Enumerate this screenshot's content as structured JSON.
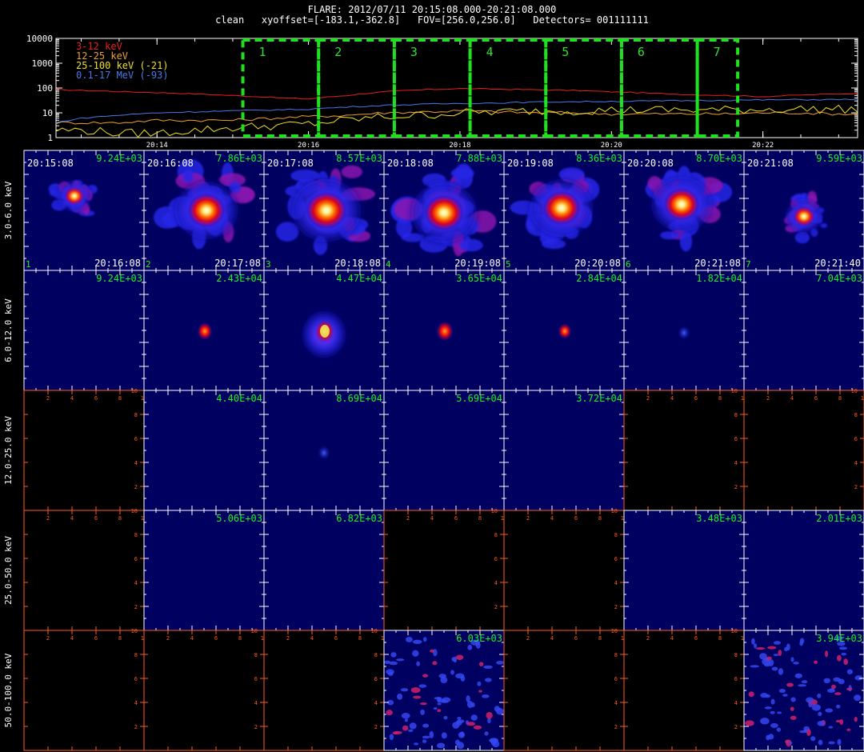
{
  "header": {
    "line1": "FLARE: 2012/07/11 20:15:08.000-20:21:08.000",
    "line2": "clean   xyoffset=[-183.1,-362.8]   FOV=[256.0,256.0]   Detectors= 001111111"
  },
  "chart_data": [
    {
      "type": "line",
      "description": "lightcurve",
      "yscale": "log",
      "ylim": [
        1,
        10000
      ],
      "y_tick_labels": [
        "1",
        "10",
        "100",
        "1000",
        "10000"
      ],
      "x_range": [
        "20:12:40",
        "20:23:15"
      ],
      "x_tick_labels": [
        "20:14",
        "20:16",
        "20:18",
        "20:20",
        "20:22"
      ],
      "grid": false,
      "legend_position": "top-left",
      "intervals": [
        {
          "label": "1",
          "start": "20:15:08",
          "end": "20:16:08"
        },
        {
          "label": "2",
          "start": "20:16:08",
          "end": "20:17:08"
        },
        {
          "label": "3",
          "start": "20:17:08",
          "end": "20:18:08"
        },
        {
          "label": "4",
          "start": "20:18:08",
          "end": "20:19:08"
        },
        {
          "label": "5",
          "start": "20:19:08",
          "end": "20:20:08"
        },
        {
          "label": "6",
          "start": "20:20:08",
          "end": "20:21:08"
        },
        {
          "label": "7",
          "start": "20:21:08",
          "end": "20:21:40"
        }
      ],
      "x": [
        "20:12:40",
        "20:13:00",
        "20:13:30",
        "20:14:00",
        "20:14:30",
        "20:15:00",
        "20:15:30",
        "20:16:00",
        "20:16:30",
        "20:17:00",
        "20:17:30",
        "20:18:00",
        "20:18:30",
        "20:19:00",
        "20:19:30",
        "20:20:00",
        "20:20:30",
        "20:21:00",
        "20:21:30",
        "20:22:00",
        "20:22:30",
        "20:23:00",
        "20:23:15"
      ],
      "series": [
        {
          "name": "3-12 keV",
          "color": "#e8201c",
          "values": [
            85,
            80,
            72,
            65,
            58,
            50,
            42,
            36,
            50,
            70,
            85,
            95,
            90,
            85,
            80,
            70,
            62,
            55,
            50,
            45,
            52,
            58,
            60
          ]
        },
        {
          "name": "12-25 keV",
          "color": "#f0a030",
          "values": [
            4,
            4,
            4,
            5,
            5,
            5,
            6,
            7,
            8,
            10,
            11,
            12,
            11,
            10,
            10,
            9,
            9,
            9,
            9,
            10,
            10,
            9,
            9
          ]
        },
        {
          "name": "25-100 keV (-21)",
          "color": "#f0e020",
          "values": [
            2,
            2,
            1.5,
            1.5,
            2,
            2.5,
            3,
            3.5,
            5,
            7,
            8,
            10,
            11,
            12,
            12,
            13,
            13,
            13,
            13,
            14,
            14,
            14,
            14
          ]
        },
        {
          "name": "0.1-17 MeV (-93)",
          "color": "#4a78e8",
          "values": [
            4,
            6,
            8,
            10,
            11,
            12,
            13,
            14,
            17,
            20,
            22,
            24,
            25,
            27,
            28,
            29,
            30,
            31,
            32,
            33,
            34,
            34,
            35
          ]
        }
      ]
    },
    {
      "type": "heatmap",
      "description": "image-grid",
      "colormap": "black-blue-red-orange-yellow-white",
      "row_labels": [
        "3.0-6.0 keV",
        "6.0-12.0 keV",
        "12.0-25.0 keV",
        "25.0-50.0 keV",
        "50.0-100.0 keV"
      ],
      "columns": [
        {
          "index": "1",
          "start": "20:15:08",
          "end": "20:16:08"
        },
        {
          "index": "2",
          "start": "20:16:08",
          "end": "20:17:08"
        },
        {
          "index": "3",
          "start": "20:17:08",
          "end": "20:18:08"
        },
        {
          "index": "4",
          "start": "20:18:08",
          "end": "20:19:08"
        },
        {
          "index": "5",
          "start": "20:19:08",
          "end": "20:20:08"
        },
        {
          "index": "6",
          "start": "20:20:08",
          "end": "20:21:08"
        },
        {
          "index": "7",
          "start": "20:21:08",
          "end": "20:21:40"
        }
      ],
      "max_values": [
        [
          "9.24E+03",
          "7.86E+03",
          "8.57E+03",
          "7.88E+03",
          "8.36E+03",
          "8.70E+03",
          "9.59E+03"
        ],
        [
          "9.24E+03",
          "2.43E+04",
          "4.47E+04",
          "3.65E+04",
          "2.84E+04",
          "1.82E+04",
          "7.04E+03"
        ],
        [
          "",
          "4.40E+04",
          "8.69E+04",
          "5.69E+04",
          "3.72E+04",
          "",
          ""
        ],
        [
          "",
          "5.06E+03",
          "6.82E+03",
          "",
          "",
          "3.48E+03",
          "2.01E+03"
        ],
        [
          "",
          "",
          "",
          "6.03E+03",
          "",
          "",
          "3.94E+03"
        ]
      ],
      "panel_state": [
        [
          "source",
          "source",
          "source",
          "source",
          "source",
          "source",
          "source"
        ],
        [
          "blank",
          "compact",
          "compact",
          "compact",
          "compact",
          "faint",
          "blank"
        ],
        [
          "empty",
          "blank",
          "faint",
          "blank",
          "blank",
          "empty",
          "empty"
        ],
        [
          "empty",
          "blank",
          "blank",
          "empty",
          "empty",
          "blank",
          "blank"
        ],
        [
          "empty",
          "empty",
          "empty",
          "noise",
          "empty",
          "empty",
          "noise"
        ]
      ],
      "empty_panel_ticks": [
        "2",
        "4",
        "6",
        "8",
        "10"
      ]
    }
  ]
}
